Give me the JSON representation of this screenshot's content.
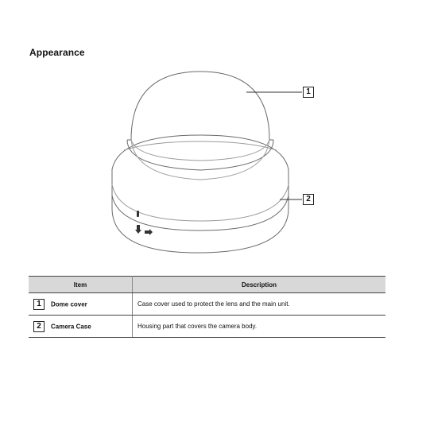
{
  "section": {
    "title": "Appearance"
  },
  "figure": {
    "callouts": [
      "1",
      "2"
    ]
  },
  "table": {
    "headers": {
      "item": "Item",
      "description": "Description"
    },
    "rows": [
      {
        "number": "1",
        "item": "Dome cover",
        "description": "Case cover used to protect the lens and the main unit."
      },
      {
        "number": "2",
        "item": "Camera Case",
        "description": "Housing part that covers the camera body."
      }
    ]
  }
}
